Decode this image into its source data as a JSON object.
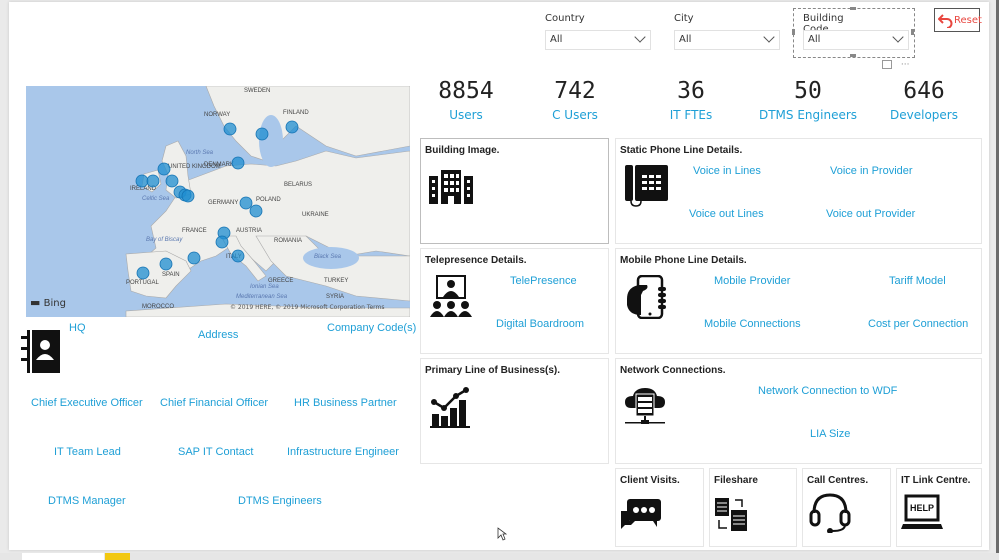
{
  "filters": {
    "country": {
      "label": "Country",
      "value": "All"
    },
    "city": {
      "label": "City",
      "value": "All"
    },
    "building_code": {
      "label": "Building Code",
      "value": "All"
    },
    "reset_label": "Reset",
    "more_options": "···"
  },
  "kpis": [
    {
      "value": "8854",
      "label": "Users"
    },
    {
      "value": "742",
      "label": "C Users"
    },
    {
      "value": "36",
      "label": "IT FTEs"
    },
    {
      "value": "50",
      "label": "DTMS Engineers"
    },
    {
      "value": "646",
      "label": "Developers"
    }
  ],
  "map": {
    "provider": "Bing",
    "copyright": "© 2019 HERE, © 2019 Microsoft Corporation Terms",
    "labels": [
      "SWEDEN",
      "NORWAY",
      "FINLAND",
      "North Sea",
      "DENMARK",
      "UNITED KINGDOM",
      "IRELAND",
      "Celtic Sea",
      "BELARUS",
      "POLAND",
      "GERMANY",
      "UKRAINE",
      "FRANCE",
      "AUSTRIA",
      "ROMANIA",
      "Bay of Biscay",
      "ITALY",
      "Black Sea",
      "SPAIN",
      "PORTUGAL",
      "GREECE",
      "TURKEY",
      "Ionian Sea",
      "Mediterranean Sea",
      "SYRIA",
      "MOROCCO"
    ],
    "marker_color": "#1f8ed0"
  },
  "hq": {
    "labels": {
      "hq": "HQ",
      "address": "Address",
      "company_codes": "Company Code(s)"
    },
    "roles": [
      "Chief Executive Officer",
      "Chief Financial Officer",
      "HR Business Partner",
      "IT Team Lead",
      "SAP IT Contact",
      "Infrastructure Engineer",
      "DTMS Manager",
      "DTMS Engineers"
    ]
  },
  "cards": {
    "building": {
      "title": "Building Image."
    },
    "static_phone": {
      "title": "Static Phone Line Details.",
      "links": [
        "Voice in Lines",
        "Voice in Provider",
        "Voice out Lines",
        "Voice out Provider"
      ]
    },
    "telepresence": {
      "title": "Telepresence Details.",
      "links": [
        "TelePresence",
        "Digital Boardroom"
      ]
    },
    "mobile": {
      "title": "Mobile Phone Line Details.",
      "links": [
        "Mobile Provider",
        "Tariff Model",
        "Mobile Connections",
        "Cost per Connection"
      ]
    },
    "business": {
      "title": "Primary Line of Business(s)."
    },
    "network": {
      "title": "Network Connections.",
      "links": [
        "Network Connection to WDF",
        "LIA Size"
      ]
    },
    "client_visits": {
      "title": "Client Visits."
    },
    "fileshare": {
      "title": "Fileshare"
    },
    "call_centres": {
      "title": "Call Centres."
    },
    "it_link": {
      "title": "IT Link Centre.",
      "help": "HELP"
    }
  },
  "colors": {
    "link": "#1e9fd6",
    "reset": "#e8463f",
    "map_water": "#a9c7ea",
    "land": "#efefec",
    "page_tab_active": "#f2c811"
  }
}
